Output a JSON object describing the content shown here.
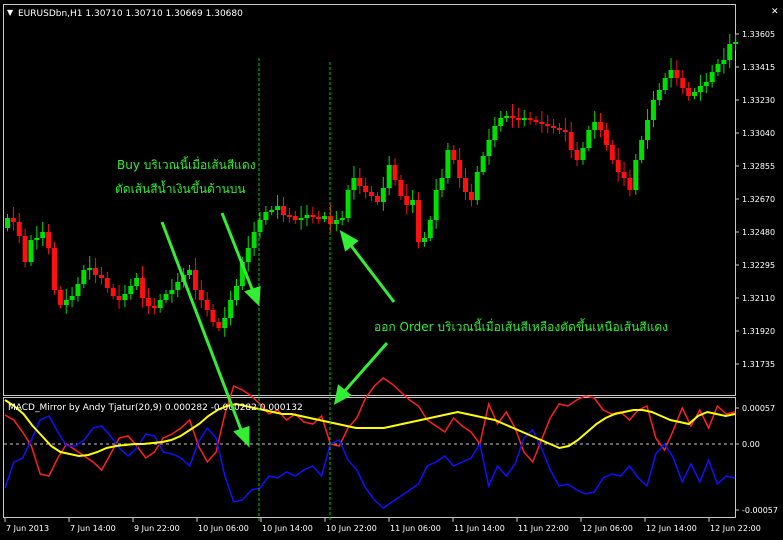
{
  "window": {
    "menu_glyph": "▼",
    "symbol_line": "EURUSDbn,H1  1.30710 1.30710 1.30669 1.30680",
    "close_glyph": "✕"
  },
  "indicator": {
    "title": "MACD_Mirror by Andy Tjatur(20,9) 0.000282 -0.000282 0.000132"
  },
  "colors": {
    "background": "#000000",
    "bull": "#00e000",
    "bear": "#ff1010",
    "frame": "#c8c8c8",
    "text": "#ffffff",
    "annotation": "#33ee33",
    "vline": "#00cc00",
    "macd_red": "#ff2020",
    "macd_blue": "#1010ff",
    "signal": "#ffff00"
  },
  "annotations": {
    "buy_line1": "Buy บริเวณนี้เมื่อเส้นสีแดง",
    "buy_line2": "ตัดเส้นสีน้ำเงินขึ้นด้านบน",
    "exit_text": "ออก Order บริเวณนี้เมื่อเส้นสีเหลืองตัดขึ้นเหนือเส้นสีแดง"
  },
  "chart_data": [
    {
      "type": "candlestick",
      "y_ticks": [
        "1.33605",
        "1.33415",
        "1.33230",
        "1.33040",
        "1.32855",
        "1.32670",
        "1.32480",
        "1.32295",
        "1.32110",
        "1.31920",
        "1.31735"
      ],
      "ylim": [
        1.31735,
        1.33605
      ],
      "vertical_markers": [
        "10 Jun 10:00",
        "11 Jun 00:00"
      ]
    },
    {
      "type": "line",
      "y_ticks": [
        "0.00057",
        "0.00",
        "-0.00057"
      ],
      "ylim": [
        -0.00057,
        0.00057
      ],
      "series_colors": [
        "#ff2020",
        "#1010ff",
        "#ffff00"
      ]
    }
  ],
  "x_ticks": [
    "7 Jun 2013",
    "7 Jun 14:00",
    "9 Jun 22:00",
    "10 Jun 06:00",
    "10 Jun 14:00",
    "10 Jun 22:00",
    "11 Jun 06:00",
    "11 Jun 14:00",
    "11 Jun 22:00",
    "12 Jun 06:00",
    "12 Jun 14:00",
    "12 Jun 22:00"
  ]
}
